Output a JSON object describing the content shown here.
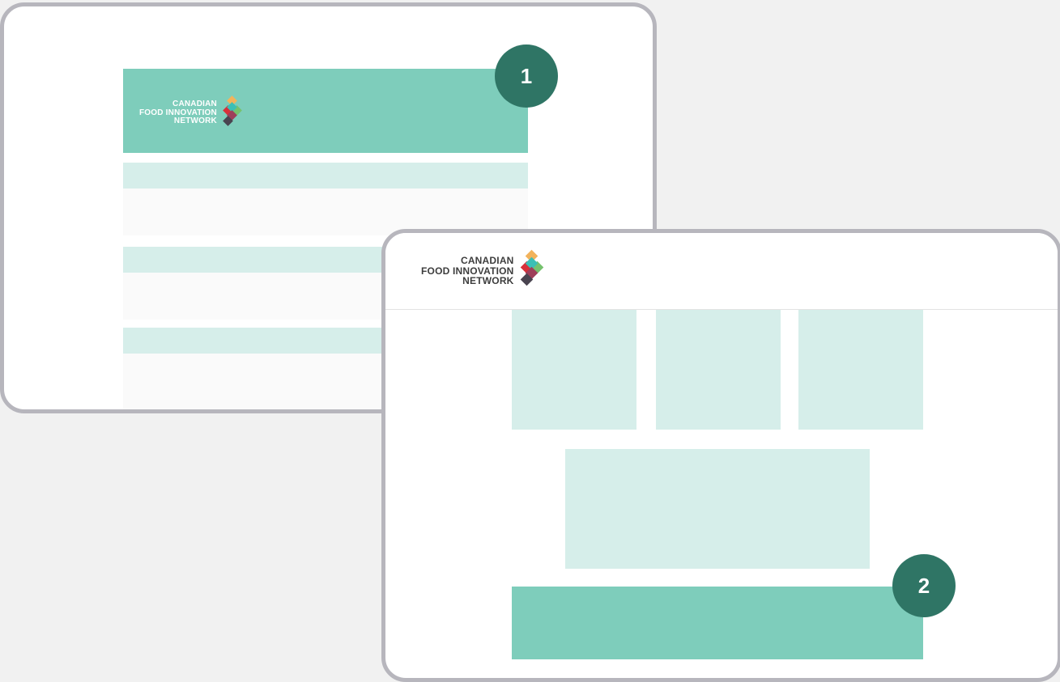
{
  "brand": {
    "name_line1": "CANADIAN",
    "name_line2": "FOOD INNOVATION",
    "name_line3": "NETWORK",
    "logo_colors": [
      "#f2b35c",
      "#d8303a",
      "#76c26e",
      "#3bbfb5",
      "#9e3f5a",
      "#4a4450"
    ]
  },
  "badges": {
    "first": "1",
    "second": "2"
  },
  "colors": {
    "background": "#f1f1f1",
    "frame_border": "#b7b6bd",
    "accent_teal": "#7ecdbb",
    "light_teal": "#d6eeea",
    "badge_green": "#2f7565"
  }
}
